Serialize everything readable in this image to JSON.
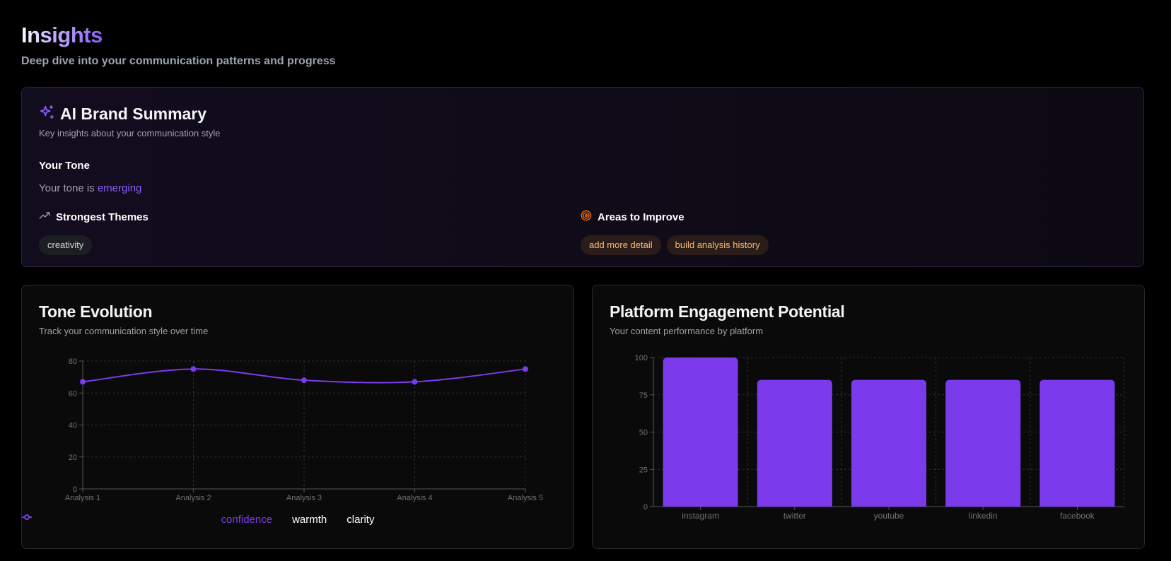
{
  "header": {
    "title": "Insights",
    "subtitle": "Deep dive into your communication patterns and progress"
  },
  "summary": {
    "title": "AI Brand Summary",
    "description": "Key insights about your communication style",
    "tone_label": "Your Tone",
    "tone_prefix": "Your tone is",
    "tone_value": "emerging",
    "themes_title": "Strongest Themes",
    "themes": [
      "creativity"
    ],
    "improve_title": "Areas to Improve",
    "improve": [
      "add more detail",
      "build analysis history"
    ],
    "icons": {
      "summary": "sparkles-icon",
      "themes": "trending-up-icon",
      "improve": "target-icon"
    },
    "colors": {
      "accent": "#8b5cf6",
      "improve": "#f97316"
    }
  },
  "tone_card": {
    "title": "Tone Evolution",
    "description": "Track your communication style over time"
  },
  "platform_card": {
    "title": "Platform Engagement Potential",
    "description": "Your content performance by platform"
  },
  "chart_data": [
    {
      "type": "line",
      "categories": [
        "Analysis 1",
        "Analysis 2",
        "Analysis 3",
        "Analysis 4",
        "Analysis 5"
      ],
      "series": [
        {
          "name": "confidence",
          "values": [
            67,
            75,
            68,
            67,
            75
          ],
          "color": "#7c3aed"
        },
        {
          "name": "warmth",
          "values": [],
          "color": "#ffffff"
        },
        {
          "name": "clarity",
          "values": [],
          "color": "#ffffff"
        }
      ],
      "yticks": [
        0,
        20,
        40,
        60,
        80
      ],
      "ylim": [
        0,
        80
      ],
      "grid": true,
      "legend": "bottom-center"
    },
    {
      "type": "bar",
      "categories": [
        "instagram",
        "twitter",
        "youtube",
        "linkedin",
        "facebook"
      ],
      "values": [
        100,
        85,
        85,
        85,
        85
      ],
      "yticks": [
        0,
        25,
        50,
        75,
        100
      ],
      "ylim": [
        0,
        100
      ],
      "grid": true,
      "color": "#7c3aed"
    }
  ]
}
